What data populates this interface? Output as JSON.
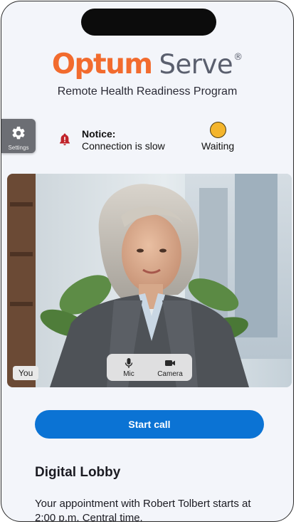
{
  "brand": {
    "name_part1": "Optum",
    "name_part2": "Serve",
    "registered_mark": "®",
    "subtitle": "Remote Health Readiness Program",
    "colors": {
      "optum_orange": "#f26b2e",
      "serve_gray": "#5a5f6e"
    }
  },
  "settings": {
    "label": "Settings",
    "icon": "gear-icon"
  },
  "notice": {
    "title": "Notice:",
    "message": "Connection is slow",
    "icon": "alert-bell-icon",
    "icon_color": "#c0232a"
  },
  "status": {
    "label": "Waiting",
    "indicator_color": "#f4b52c"
  },
  "video": {
    "self_label": "You",
    "controls": [
      {
        "label": "Mic",
        "icon": "microphone-icon"
      },
      {
        "label": "Camera",
        "icon": "video-camera-icon"
      }
    ]
  },
  "actions": {
    "start_call_label": "Start call",
    "accent_color": "#0b73d4"
  },
  "lobby": {
    "heading": "Digital Lobby",
    "appointment_text": "Your appointment with Robert Tolbert starts at 2:00 p.m. Central time."
  }
}
